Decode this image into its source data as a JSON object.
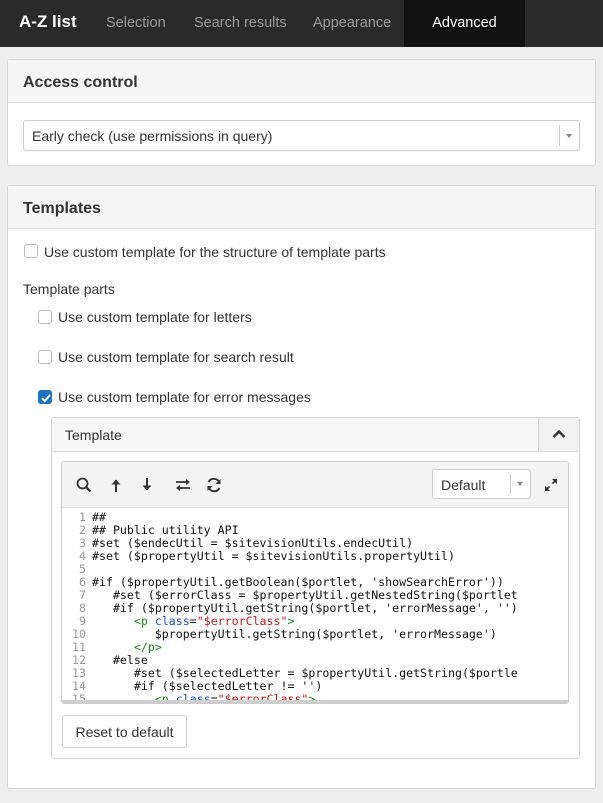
{
  "nav": {
    "brand": "A-Z list",
    "tabs": [
      "Selection",
      "Search results",
      "Appearance"
    ],
    "active_tab": "Advanced"
  },
  "access": {
    "title": "Access control",
    "select_value": "Early check (use permissions in query)"
  },
  "templates": {
    "title": "Templates",
    "structure_checkbox": {
      "label": "Use custom template for the structure of template parts",
      "checked": false
    },
    "parts_label": "Template parts",
    "letters_checkbox": {
      "label": "Use custom template for letters",
      "checked": false
    },
    "search_checkbox": {
      "label": "Use custom template for search result",
      "checked": false
    },
    "error_checkbox": {
      "label": "Use custom template for error messages",
      "checked": true
    },
    "template_box": {
      "header": "Template",
      "theme_select": "Default",
      "reset_button": "Reset to default",
      "line_numbers": [
        "1",
        "2",
        "3",
        "4",
        "5",
        "6",
        "7",
        "8",
        "9",
        "10",
        "11",
        "12",
        "13",
        "14",
        "15"
      ],
      "code_lines": [
        "##",
        "## Public utility API",
        "#set ($endecUtil = $sitevisionUtils.endecUtil)",
        "#set ($propertyUtil = $sitevisionUtils.propertyUtil)",
        "",
        "#if ($propertyUtil.getBoolean($portlet, 'showSearchError'))",
        "   #set ($errorClass = $propertyUtil.getNestedString($portlet",
        "   #if ($propertyUtil.getString($portlet, 'errorMessage', '')",
        "      <p class=\"$errorClass\">",
        "         $propertyUtil.getString($portlet, 'errorMessage')",
        "      </p>",
        "   #else",
        "      #set ($selectedLetter = $propertyUtil.getString($portle",
        "      #if ($selectedLetter != '')",
        "         <p class=\"$errorClass\">"
      ]
    }
  },
  "icons": {
    "toolbar": [
      "search-icon",
      "arrow-up-icon",
      "arrow-down-icon",
      "swap-icon",
      "refresh-icon"
    ],
    "expand": "expand-icon",
    "collapse": "chevron-up-icon",
    "checkmark": "check-icon"
  },
  "colors": {
    "nav_bg": "#2a2a2a",
    "nav_active_bg": "#111111",
    "checkbox_on": "#1a73c4",
    "code_tag": "#1a8a1a",
    "code_attr": "#1a4ec4",
    "code_string": "#c41a1a"
  }
}
